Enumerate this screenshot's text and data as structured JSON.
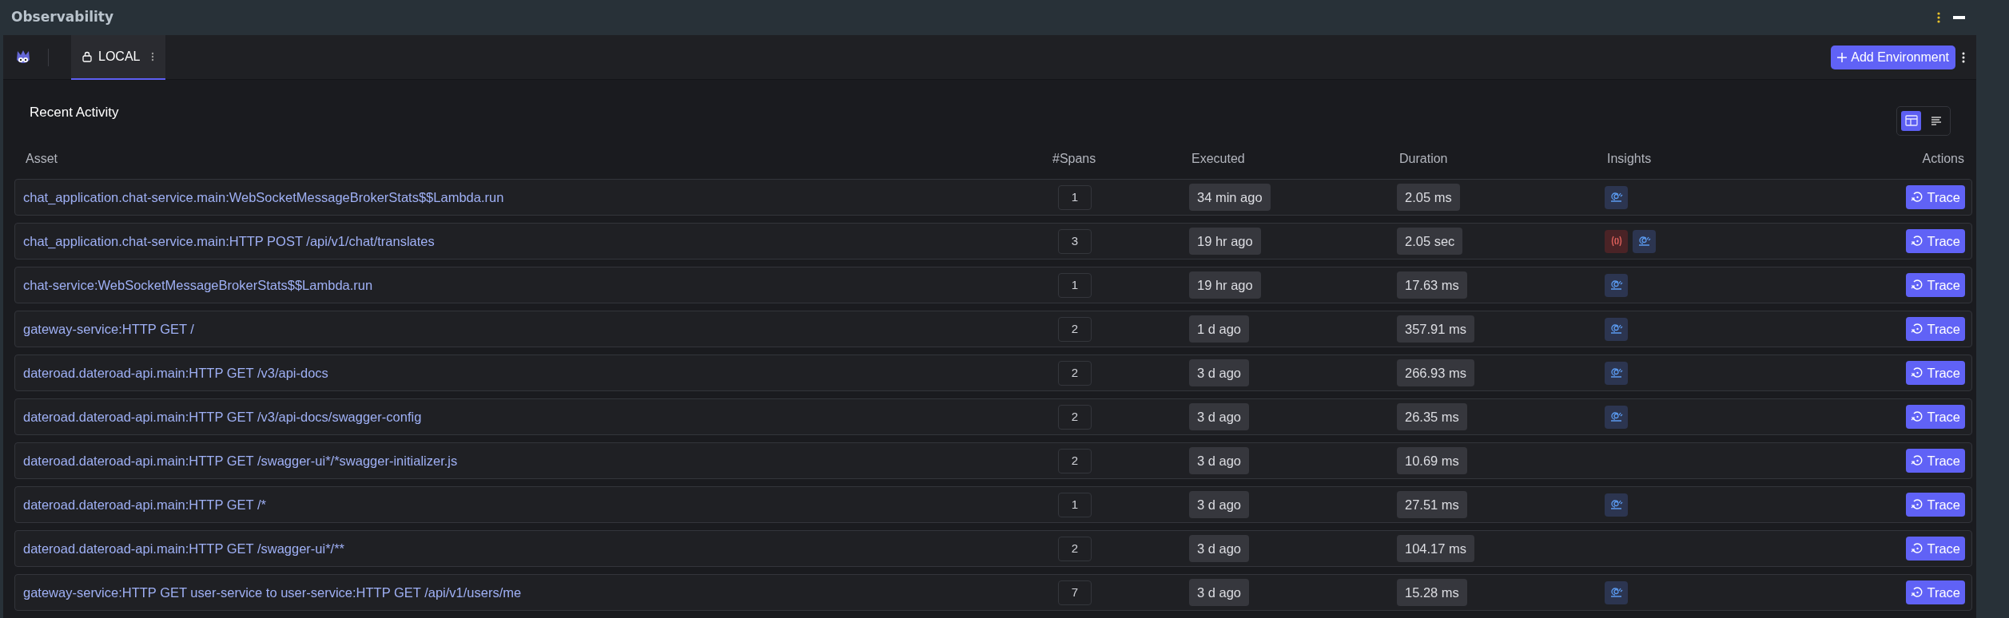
{
  "window": {
    "title": "Observability"
  },
  "tabs": [
    {
      "label": "LOCAL",
      "selected": true,
      "locked": true
    }
  ],
  "add_environment_button": "Add Environment",
  "section": {
    "title": "Recent Activity",
    "view_modes": [
      {
        "kind": "table",
        "selected": true
      },
      {
        "kind": "list",
        "selected": false
      }
    ]
  },
  "table": {
    "columns": [
      "Asset",
      "#Spans",
      "Executed",
      "Duration",
      "Insights",
      "Actions"
    ],
    "rows": [
      {
        "asset": "chat_application.chat-service.main:WebSocketMessageBrokerStats$$Lambda.run",
        "spans": "1",
        "executed": "34 min ago",
        "duration": "2.05 ms",
        "insights": [
          {
            "kind": "slow"
          }
        ],
        "action": "Trace"
      },
      {
        "asset": "chat_application.chat-service.main:HTTP POST /api/v1/chat/translates",
        "spans": "3",
        "executed": "19 hr ago",
        "duration": "2.05 sec",
        "insights": [
          {
            "kind": "error"
          },
          {
            "kind": "slow"
          }
        ],
        "action": "Trace"
      },
      {
        "asset": "chat-service:WebSocketMessageBrokerStats$$Lambda.run",
        "spans": "1",
        "executed": "19 hr ago",
        "duration": "17.63 ms",
        "insights": [
          {
            "kind": "slow"
          }
        ],
        "action": "Trace"
      },
      {
        "asset": "gateway-service:HTTP GET /",
        "spans": "2",
        "executed": "1 d ago",
        "duration": "357.91 ms",
        "insights": [
          {
            "kind": "slow"
          }
        ],
        "action": "Trace"
      },
      {
        "asset": "dateroad.dateroad-api.main:HTTP GET /v3/api-docs",
        "spans": "2",
        "executed": "3 d ago",
        "duration": "266.93 ms",
        "insights": [
          {
            "kind": "slow"
          }
        ],
        "action": "Trace"
      },
      {
        "asset": "dateroad.dateroad-api.main:HTTP GET /v3/api-docs/swagger-config",
        "spans": "2",
        "executed": "3 d ago",
        "duration": "26.35 ms",
        "insights": [
          {
            "kind": "slow"
          }
        ],
        "action": "Trace"
      },
      {
        "asset": "dateroad.dateroad-api.main:HTTP GET /swagger-ui*/*swagger-initializer.js",
        "spans": "2",
        "executed": "3 d ago",
        "duration": "10.69 ms",
        "insights": [],
        "action": "Trace"
      },
      {
        "asset": "dateroad.dateroad-api.main:HTTP GET /*",
        "spans": "1",
        "executed": "3 d ago",
        "duration": "27.51 ms",
        "insights": [
          {
            "kind": "slow"
          }
        ],
        "action": "Trace"
      },
      {
        "asset": "dateroad.dateroad-api.main:HTTP GET /swagger-ui*/**",
        "spans": "2",
        "executed": "3 d ago",
        "duration": "104.17 ms",
        "insights": [],
        "action": "Trace"
      },
      {
        "asset": "gateway-service:HTTP GET user-service to user-service:HTTP GET /api/v1/users/me",
        "spans": "7",
        "executed": "3 d ago",
        "duration": "15.28 ms",
        "insights": [
          {
            "kind": "slow"
          }
        ],
        "action": "Trace"
      }
    ]
  }
}
